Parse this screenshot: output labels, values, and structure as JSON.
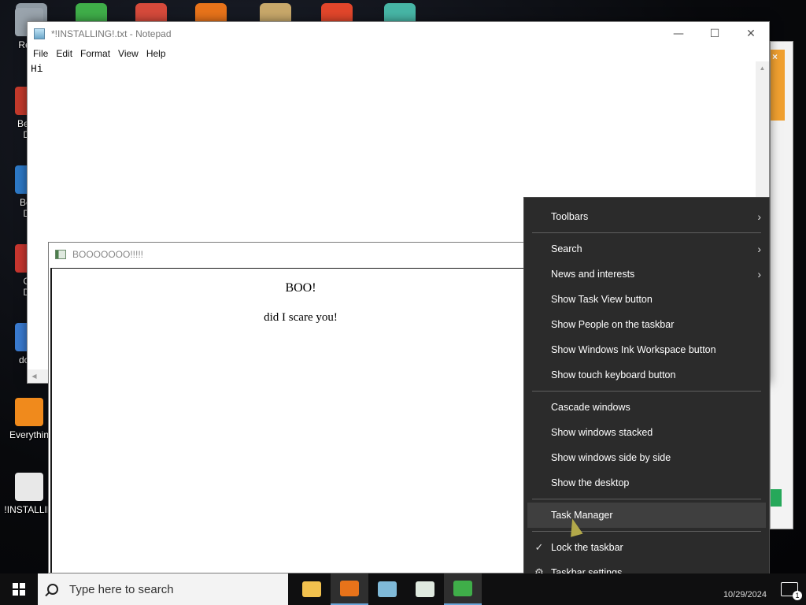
{
  "desktop": {
    "icons": [
      {
        "label": "Recy",
        "color": "#9aa4ad"
      },
      {
        "label": "Bejev\nDe",
        "color": "#c43a2c"
      },
      {
        "label": "Beje\nDe",
        "color": "#2d79c7"
      },
      {
        "label": "Ch\nDe",
        "color": "#c8362f"
      },
      {
        "label": "does",
        "color": "#3a7bd0"
      },
      {
        "label": "Everythin",
        "color": "#f08a1c"
      },
      {
        "label": "!INSTALLIN",
        "color": "#e8e8e8"
      }
    ]
  },
  "notepad": {
    "title": "*!INSTALLING!.txt - Notepad",
    "menu": [
      "File",
      "Edit",
      "Format",
      "View",
      "Help"
    ],
    "content": "Hi",
    "controls": {
      "minimize": "—",
      "maximize": "☐",
      "close": "✕"
    }
  },
  "boo_window": {
    "title": "BOOOOOOO!!!!!",
    "heading": "BOO!",
    "text": "did I scare you!"
  },
  "context_menu": {
    "items": [
      {
        "label": "Toolbars",
        "submenu": true
      },
      {
        "separator": true
      },
      {
        "label": "Search",
        "submenu": true
      },
      {
        "label": "News and interests",
        "submenu": true
      },
      {
        "label": "Show Task View button"
      },
      {
        "label": "Show People on the taskbar"
      },
      {
        "label": "Show Windows Ink Workspace button"
      },
      {
        "label": "Show touch keyboard button"
      },
      {
        "separator": true
      },
      {
        "label": "Cascade windows"
      },
      {
        "label": "Show windows stacked"
      },
      {
        "label": "Show windows side by side"
      },
      {
        "label": "Show the desktop"
      },
      {
        "separator": true
      },
      {
        "label": "Task Manager",
        "hover": true
      },
      {
        "separator": true
      },
      {
        "label": "Lock the taskbar",
        "lead_icon": "check-icon",
        "lead": "✓"
      },
      {
        "label": "Taskbar settings",
        "lead_icon": "gear-icon",
        "lead": "⚙"
      }
    ]
  },
  "taskbar": {
    "search_placeholder": "Type here to search",
    "apps": [
      {
        "name": "file-explorer",
        "color": "#f2c14e",
        "active": false
      },
      {
        "name": "firefox",
        "color": "#e8731a",
        "active": true
      },
      {
        "name": "notepad",
        "color": "#7fb9d8",
        "active": false
      },
      {
        "name": "boo-app",
        "color": "#dfe9df",
        "active": false
      },
      {
        "name": "people",
        "color": "#3fae49",
        "active": true
      }
    ],
    "date": "10/29/2024",
    "notification_count": "1"
  }
}
